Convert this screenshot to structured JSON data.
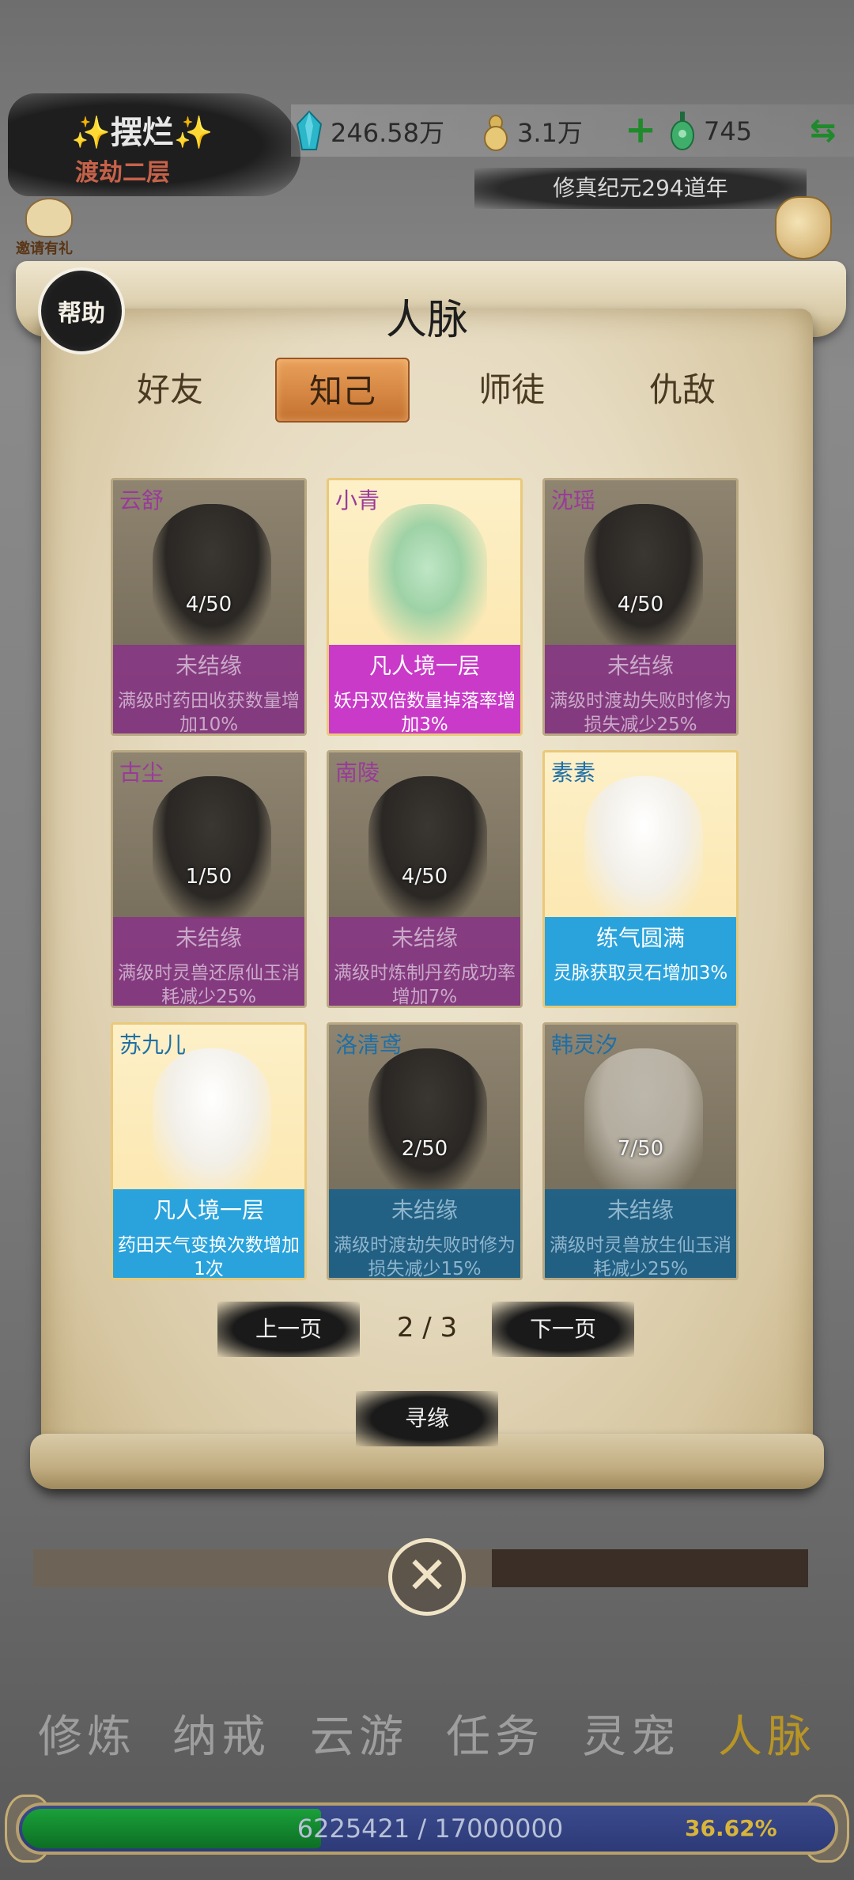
{
  "header": {
    "player_name": "摆烂",
    "sparkle": "✨",
    "realm": "渡劫二层",
    "resources": [
      {
        "icon": "spirit-stone-icon",
        "value": "246.58万",
        "color": "#2bb6c9"
      },
      {
        "icon": "gold-gourd-icon",
        "value": "3.1万",
        "color": "#c9a24a"
      },
      {
        "icon": "jade-pendant-icon",
        "value": "745",
        "color": "#3fae6b"
      }
    ],
    "plus": "+",
    "swap": "⇆",
    "era": "修真纪元294道年",
    "invite": "邀请有礼"
  },
  "panel": {
    "help": "帮助",
    "title": "人脉",
    "tabs": [
      "好友",
      "知己",
      "师徒",
      "仇敌"
    ],
    "active_tab": "知己",
    "cards": [
      {
        "name": "云舒",
        "progress": "4/50",
        "status": "未结缘",
        "desc": "满级时药田收获数量增加10%"
      },
      {
        "name": "小青",
        "progress": "",
        "status": "凡人境一层",
        "desc": "妖丹双倍数量掉落率增加3%"
      },
      {
        "name": "沈瑶",
        "progress": "4/50",
        "status": "未结缘",
        "desc": "满级时渡劫失败时修为损失减少25%"
      },
      {
        "name": "古尘",
        "progress": "1/50",
        "status": "未结缘",
        "desc": "满级时灵兽还原仙玉消耗减少25%"
      },
      {
        "name": "南陵",
        "progress": "4/50",
        "status": "未结缘",
        "desc": "满级时炼制丹药成功率增加7%"
      },
      {
        "name": "素素",
        "progress": "",
        "status": "练气圆满",
        "desc": "灵脉获取灵石增加3%"
      },
      {
        "name": "苏九儿",
        "progress": "",
        "status": "凡人境一层",
        "desc": "药田天气变换次数增加1次"
      },
      {
        "name": "洛清鸢",
        "progress": "2/50",
        "status": "未结缘",
        "desc": "满级时渡劫失败时修为损失减少15%"
      },
      {
        "name": "韩灵汐",
        "progress": "7/50",
        "status": "未结缘",
        "desc": "满级时灵兽放生仙玉消耗减少25%"
      }
    ],
    "prev": "上一页",
    "page": "2 / 3",
    "next": "下一页",
    "seek": "寻缘"
  },
  "close": "✕",
  "nav": {
    "items": [
      "修炼",
      "纳戒",
      "云游",
      "任务",
      "灵宠",
      "人脉"
    ],
    "active": "人脉"
  },
  "xp": {
    "text": "6225421 / 17000000",
    "percent": "36.62%",
    "fraction": 0.3662
  }
}
